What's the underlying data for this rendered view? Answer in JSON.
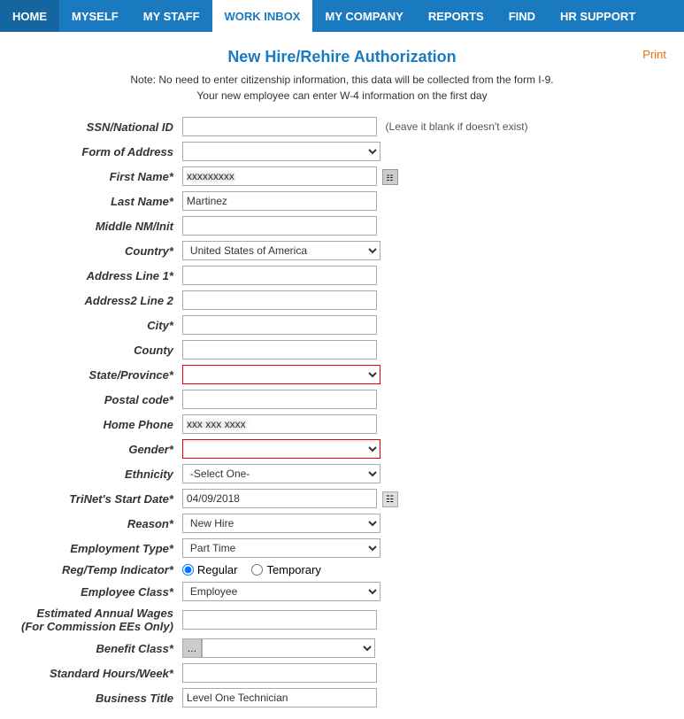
{
  "nav": {
    "items": [
      {
        "label": "HOME",
        "active": false
      },
      {
        "label": "MYSELF",
        "active": false
      },
      {
        "label": "MY STAFF",
        "active": false
      },
      {
        "label": "WORK INBOX",
        "active": true
      },
      {
        "label": "MY COMPANY",
        "active": false
      },
      {
        "label": "REPORTS",
        "active": false
      },
      {
        "label": "FIND",
        "active": false
      },
      {
        "label": "HR SUPPORT",
        "active": false
      }
    ]
  },
  "page": {
    "title": "New Hire/Rehire Authorization",
    "print_label": "Print",
    "note_line1": "Note: No need to enter citizenship information, this data will be collected from the form I-9.",
    "note_line2": "Your new employee can enter W-4 information on the first day"
  },
  "form": {
    "ssn_label": "SSN/National ID",
    "ssn_hint": "(Leave it blank if doesn't exist)",
    "form_address_label": "Form of Address",
    "first_name_label": "First Name*",
    "last_name_label": "Last Name*",
    "last_name_value": "Martinez",
    "middle_nm_label": "Middle NM/Init",
    "country_label": "Country*",
    "country_value": "United States of America",
    "address1_label": "Address Line 1*",
    "address2_label": "Address2 Line 2",
    "city_label": "City*",
    "county_label": "County",
    "state_label": "State/Province*",
    "postal_label": "Postal code*",
    "home_phone_label": "Home Phone",
    "gender_label": "Gender*",
    "ethnicity_label": "Ethnicity",
    "ethnicity_value": "-Select One-",
    "trinet_date_label": "TriNet's Start Date*",
    "trinet_date_value": "04/09/2018",
    "reason_label": "Reason*",
    "reason_value": "New Hire",
    "employment_type_label": "Employment Type*",
    "employment_type_value": "Part Time",
    "reg_temp_label": "Reg/Temp Indicator*",
    "regular_label": "Regular",
    "temporary_label": "Temporary",
    "employee_class_label": "Employee Class*",
    "employee_class_value": "Employee",
    "est_wages_label": "Estimated Annual Wages",
    "est_wages_label2": "(For Commission EEs Only)",
    "benefit_class_label": "Benefit Class*",
    "standard_hours_label": "Standard Hours/Week*",
    "business_title_label": "Business Title",
    "business_title_value": "Level One Technician"
  }
}
